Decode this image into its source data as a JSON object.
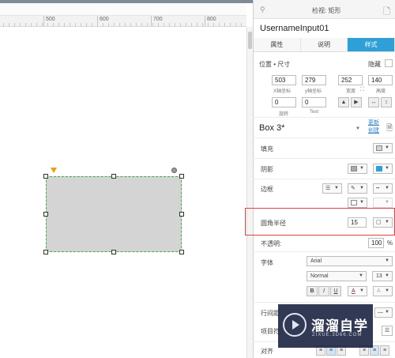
{
  "canvas": {
    "ruler_labels": [
      "500",
      "600",
      "700",
      "800"
    ]
  },
  "panel": {
    "title": "检视: 矩形",
    "shape_name": "UsernameInput01",
    "tabs": [
      {
        "label": "属性",
        "active": false
      },
      {
        "label": "说明",
        "active": false
      },
      {
        "label": "样式",
        "active": true
      }
    ],
    "position_size": {
      "label": "位置 • 尺寸",
      "hide_label": "隐藏",
      "x": "503",
      "y": "279",
      "width": "252",
      "height": "140",
      "x_label": "X轴坐标",
      "y_label": "y轴坐标",
      "width_label": "宽度",
      "height_label": "高度",
      "rotation": "0",
      "text_rotation": "0",
      "rotation_label": "旋转",
      "text_label": "Text"
    },
    "style": {
      "name": "Box 3*",
      "update_label": "更新",
      "create_label": "创建"
    },
    "fill_label": "填充",
    "shadow_label": "阴影",
    "border_label": "边框",
    "corner_radius": {
      "label": "圆角半径",
      "value": "15"
    },
    "opacity": {
      "label": "不透明:",
      "value": "100",
      "unit": "%"
    },
    "font": {
      "label": "字体",
      "family": "Arial",
      "weight": "Normal",
      "size": "13",
      "bold": "B",
      "italic": "I",
      "underline": "U",
      "color_glyph": "A",
      "effect_glyph": "A"
    },
    "line_spacing_label": "行间距",
    "bullet_label": "项目符",
    "align_label": "对齐",
    "colors": {
      "accent": "#2f9fd8",
      "shape_fill": "#d4d4d4",
      "selection": "#3cb043",
      "highlight": "#e04040"
    }
  },
  "watermark": {
    "brand": "溜溜自学",
    "url": "ZIXUE.3D66.COM"
  }
}
